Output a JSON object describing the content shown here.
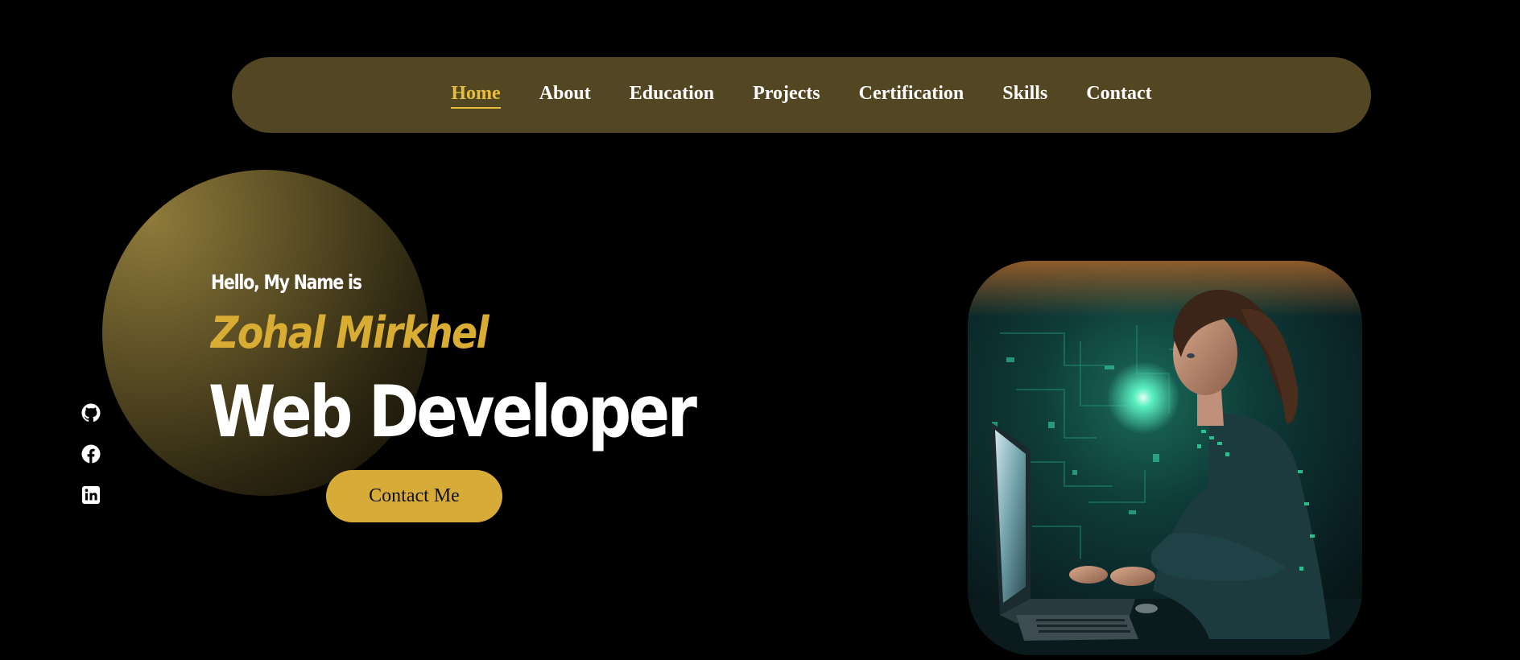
{
  "nav": {
    "items": [
      {
        "label": "Home",
        "active": true
      },
      {
        "label": "About",
        "active": false
      },
      {
        "label": "Education",
        "active": false
      },
      {
        "label": "Projects",
        "active": false
      },
      {
        "label": "Certification",
        "active": false
      },
      {
        "label": "Skills",
        "active": false
      },
      {
        "label": "Contact",
        "active": false
      }
    ]
  },
  "hero": {
    "greeting": "Hello, My Name is",
    "name": "Zohal Mirkhel",
    "role": "Web Developer",
    "cta_label": "Contact Me"
  },
  "social": {
    "icons": [
      "github-icon",
      "facebook-icon",
      "linkedin-icon"
    ]
  },
  "illustration": {
    "subject": "woman-at-laptop-illustration"
  },
  "colors": {
    "background": "#000000",
    "navbar": "#524623",
    "accent": "#e7bd3d",
    "name": "#d9ad34",
    "button": "#d6ab38",
    "text": "#ffffff"
  }
}
